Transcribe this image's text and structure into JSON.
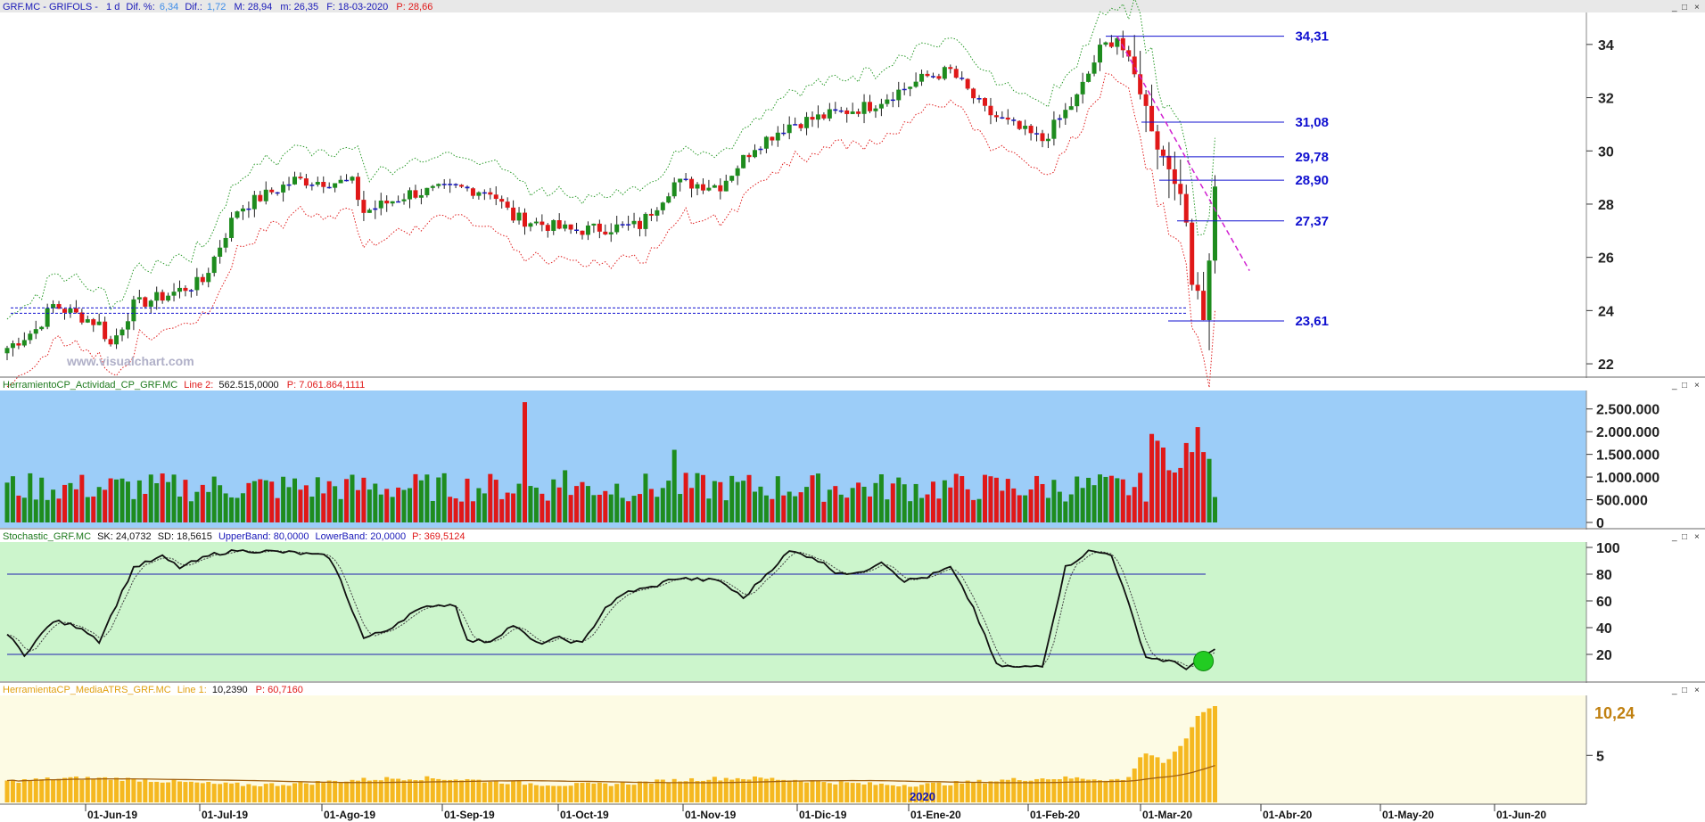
{
  "header": {
    "symbol": "GRF.MC - GRIFOLS -",
    "period": "1 d",
    "dif_pct_label": "Dif. %:",
    "dif_pct": "6,34",
    "dif_label": "Dif.:",
    "dif": "1,72",
    "max": "M: 28,94",
    "min": "m: 26,35",
    "date": "F: 18-03-2020",
    "last": "P: 28,66"
  },
  "watermark": "www.visualchart.com",
  "window_controls": [
    "_",
    "□",
    "×"
  ],
  "colors": {
    "up": "#1e8c1e",
    "down": "#e01818",
    "doji": "#1818c0",
    "level_line": "#1010d0",
    "trend_line": "#d020d0",
    "upper_band": "#2a9a2a",
    "lower_band": "#e02020",
    "volume_bg": "#9ccdf8",
    "stoch_bg": "#ccf5cc",
    "atr_bg": "#fdfbe4",
    "atr_bar": "#f5b820"
  },
  "chart_data": [
    {
      "type": "candlestick",
      "title": "GRF.MC - GRIFOLS - 1 d",
      "ylim": [
        21.6,
        35
      ],
      "y_ticks": [
        "34",
        "32",
        "30",
        "28",
        "26",
        "24",
        "22"
      ],
      "y_tick_values": [
        34,
        32,
        30,
        28,
        26,
        24,
        22
      ],
      "x_ticks": [
        "01-Jun-19",
        "01-Jul-19",
        "01-Ago-19",
        "01-Sep-19",
        "01-Oct-19",
        "01-Nov-19",
        "01-Dic-19",
        "01-Ene-20",
        "01-Feb-20",
        "01-Mar-20",
        "01-Abr-20",
        "01-May-20",
        "01-Jun-20"
      ],
      "year_marker": "2020",
      "bars": 211,
      "anchors": [
        [
          0,
          22.6
        ],
        [
          5,
          23.3
        ],
        [
          8,
          24.2
        ],
        [
          16,
          23.5
        ],
        [
          18,
          22.7
        ],
        [
          22,
          24.2
        ],
        [
          28,
          24.6
        ],
        [
          34,
          25.1
        ],
        [
          40,
          27.8
        ],
        [
          50,
          28.9
        ],
        [
          60,
          28.8
        ],
        [
          62,
          27.7
        ],
        [
          70,
          28.4
        ],
        [
          78,
          28.6
        ],
        [
          84,
          28.5
        ],
        [
          88,
          27.5
        ],
        [
          98,
          27.0
        ],
        [
          110,
          27.2
        ],
        [
          116,
          28.8
        ],
        [
          124,
          28.7
        ],
        [
          130,
          30.2
        ],
        [
          136,
          31.0
        ],
        [
          142,
          31.3
        ],
        [
          150,
          31.7
        ],
        [
          160,
          32.8
        ],
        [
          164,
          33.0
        ],
        [
          170,
          31.5
        ],
        [
          176,
          30.8
        ],
        [
          180,
          30.4
        ],
        [
          186,
          32.0
        ],
        [
          190,
          33.8
        ],
        [
          193,
          34.3
        ],
        [
          197,
          32.3
        ],
        [
          200,
          30.2
        ],
        [
          203,
          29.0
        ],
        [
          205,
          27.3
        ],
        [
          206,
          25.2
        ],
        [
          207,
          24.8
        ],
        [
          208,
          23.8
        ],
        [
          209,
          25.8
        ],
        [
          210,
          28.66
        ]
      ],
      "levels": [
        {
          "label": "34,31",
          "value": 34.31
        },
        {
          "label": "31,08",
          "value": 31.08
        },
        {
          "label": "29,78",
          "value": 29.78
        },
        {
          "label": "28,90",
          "value": 28.9
        },
        {
          "label": "27,37",
          "value": 27.37
        },
        {
          "label": "23,61",
          "value": 23.61
        }
      ],
      "support_lines": [
        24.1,
        23.9
      ],
      "trend_line": {
        "from": {
          "bar": 193,
          "value": 34.31
        },
        "to": {
          "bar": 216,
          "value": 25.5
        }
      },
      "series": [
        {
          "name": "Upper band"
        },
        {
          "name": "Lower band"
        }
      ]
    },
    {
      "type": "bar",
      "title": "HerramientoCP_Actividad_CP_GRF.MC",
      "line_label": "Line 2:",
      "line_value": "562.515,0000",
      "p_label": "P: 7.061.864,1111",
      "ylim": [
        0,
        2750000
      ],
      "y_ticks": [
        "2.500.000",
        "2.000.000",
        "1.500.000",
        "1.000.000",
        "500.000",
        "0"
      ],
      "y_tick_values": [
        2500000,
        2000000,
        1500000,
        1000000,
        500000,
        0
      ],
      "spikes": [
        [
          90,
          2650000
        ],
        [
          116,
          1600000
        ],
        [
          97,
          1150000
        ]
      ],
      "last_values": [
        1950000,
        1800000,
        1650000,
        1150000,
        1100000,
        1200000,
        1750000,
        1550000,
        2100000,
        1550000,
        1400000,
        560000
      ]
    },
    {
      "type": "line",
      "title": "Stochastic_GRF.MC",
      "sk_label": "SK: 24,0732",
      "sd_label": "SD: 18,5615",
      "upper_label": "UpperBand: 80,0000",
      "lower_label": "LowerBand: 20,0000",
      "p_label": "P: 369,5124",
      "ylim": [
        0,
        100
      ],
      "y_ticks": [
        "100",
        "80",
        "60",
        "40",
        "20"
      ],
      "y_tick_values": [
        100,
        80,
        60,
        40,
        20
      ],
      "bands": [
        80,
        20
      ],
      "anchors": [
        [
          0,
          35
        ],
        [
          3,
          20
        ],
        [
          8,
          45
        ],
        [
          13,
          40
        ],
        [
          16,
          30
        ],
        [
          22,
          85
        ],
        [
          27,
          93
        ],
        [
          30,
          85
        ],
        [
          36,
          95
        ],
        [
          40,
          98
        ],
        [
          50,
          96
        ],
        [
          56,
          93
        ],
        [
          58,
          75
        ],
        [
          62,
          32
        ],
        [
          66,
          38
        ],
        [
          70,
          50
        ],
        [
          74,
          57
        ],
        [
          78,
          57
        ],
        [
          80,
          30
        ],
        [
          84,
          30
        ],
        [
          88,
          42
        ],
        [
          92,
          28
        ],
        [
          96,
          32
        ],
        [
          100,
          28
        ],
        [
          104,
          55
        ],
        [
          108,
          67
        ],
        [
          112,
          70
        ],
        [
          116,
          77
        ],
        [
          124,
          75
        ],
        [
          128,
          62
        ],
        [
          132,
          80
        ],
        [
          136,
          97
        ],
        [
          140,
          93
        ],
        [
          144,
          82
        ],
        [
          148,
          80
        ],
        [
          152,
          90
        ],
        [
          156,
          75
        ],
        [
          160,
          78
        ],
        [
          164,
          85
        ],
        [
          168,
          55
        ],
        [
          172,
          12
        ],
        [
          176,
          10
        ],
        [
          180,
          12
        ],
        [
          184,
          85
        ],
        [
          188,
          97
        ],
        [
          192,
          95
        ],
        [
          194,
          70
        ],
        [
          198,
          18
        ],
        [
          202,
          15
        ],
        [
          205,
          10
        ],
        [
          207,
          15
        ],
        [
          210,
          24
        ]
      ]
    },
    {
      "type": "bar",
      "title": "HerramientaCP_MediaATRS_GRF.MC",
      "line_label": "Line 1:",
      "line_value": "10,2390",
      "p_label": "P: 60,7160",
      "last_value_label": "10,24",
      "ylim": [
        0,
        11
      ],
      "y_ticks": [
        "5"
      ],
      "y_tick_values": [
        5
      ],
      "last_values": [
        2.7,
        3.6,
        4.8,
        5.2,
        5.0,
        4.8,
        4.2,
        4.6,
        5.4,
        6.0,
        6.8,
        8.0,
        9.2,
        9.6,
        10.0,
        10.24
      ]
    }
  ]
}
